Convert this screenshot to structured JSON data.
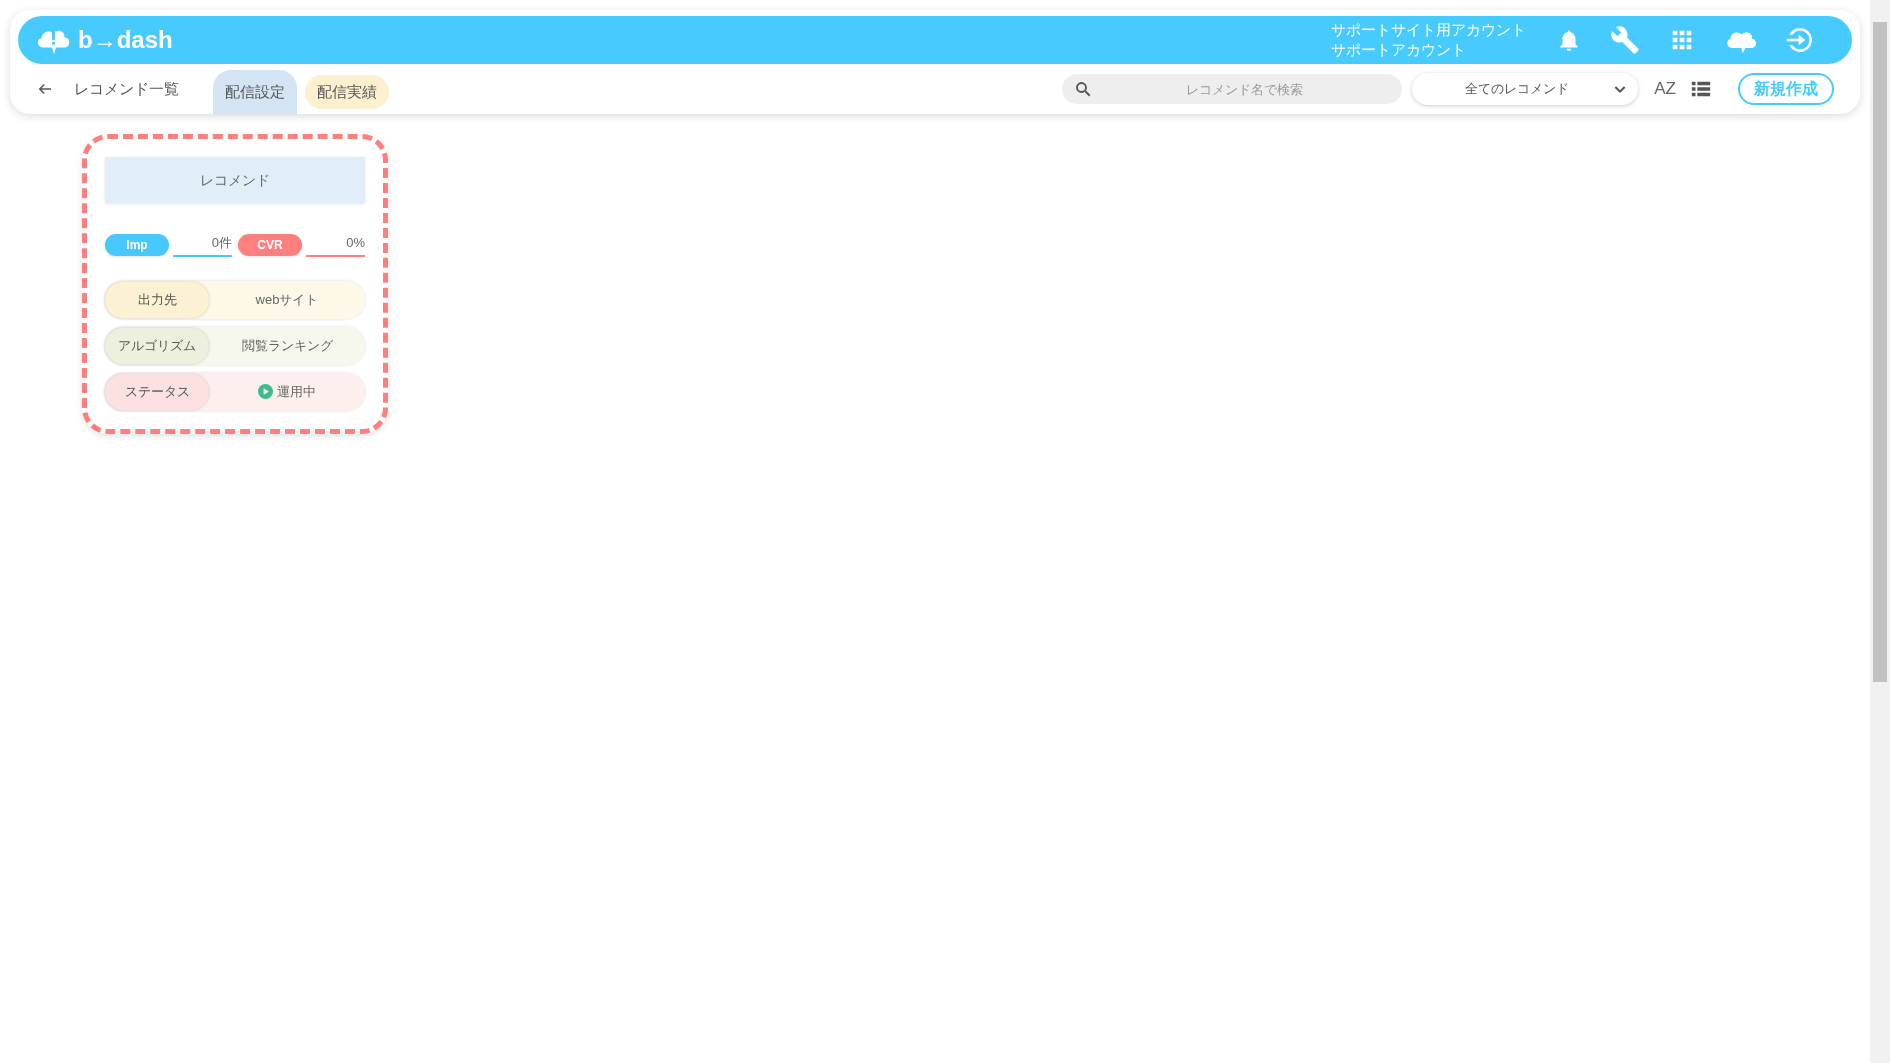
{
  "header": {
    "logo_text": "b→dash",
    "account_lines": [
      "サポートサイト用アカウント",
      "サポートアカウント"
    ]
  },
  "toolbar": {
    "back_label": "レコメンド一覧",
    "tabs": [
      {
        "label": "配信設定",
        "selected": true
      },
      {
        "label": "配信実績",
        "selected": false
      }
    ],
    "search": {
      "placeholder": "レコメンド名で検索"
    },
    "filter": {
      "value": "全てのレコメンド"
    },
    "sort_label": "AZ",
    "new_button": "新規作成"
  },
  "cards": [
    {
      "title": "レコメンド",
      "selected": true,
      "metrics": [
        {
          "label": "Imp",
          "value": "0件",
          "color": "#47c8ff"
        },
        {
          "label": "CVR",
          "value": "0%",
          "color": "#ff7f7f"
        }
      ],
      "rows": [
        {
          "kind": "text",
          "label": "出力先",
          "value": "webサイト",
          "color": "#fcf1d2"
        },
        {
          "kind": "text",
          "label": "アルゴリズム",
          "value": "閲覧ランキング",
          "color": "#edf0dc"
        },
        {
          "kind": "status",
          "label": "ステータス",
          "value": "運用中",
          "color": "#fde0e0"
        }
      ]
    }
  ]
}
